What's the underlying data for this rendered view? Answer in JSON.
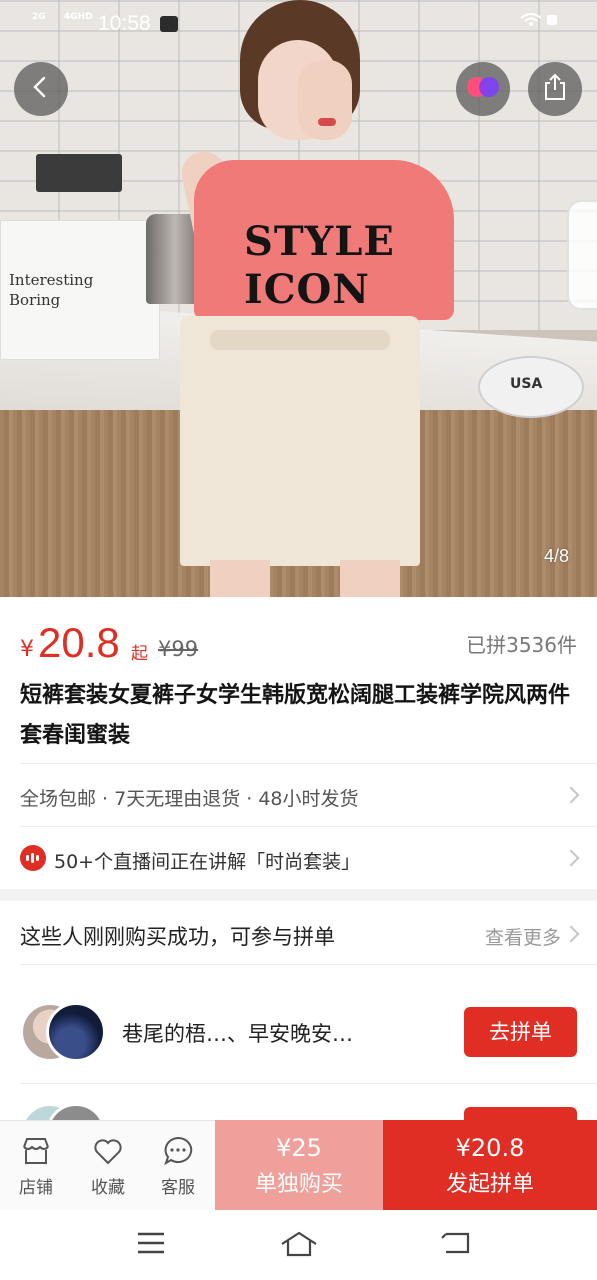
{
  "status_bar": {
    "net1": "2G",
    "net2": "4GHD",
    "time": "10:58"
  },
  "hero": {
    "counter": "4/8",
    "bag_text_1": "Interesting",
    "bag_text_2": "Boring",
    "tshirt_line_1": "STYLE",
    "tshirt_line_2": "ICON",
    "purse_text": "USA"
  },
  "price": {
    "currency": "¥",
    "value": "20.8",
    "suffix": "起",
    "original": "¥99",
    "sold": "已拼3536件"
  },
  "product": {
    "title": "短裤套装女夏裤子女学生韩版宽松阔腿工装裤学院风两件套春闺蜜装"
  },
  "promo": {
    "text": "全场包邮 · 7天无理由退货 · 48小时发货"
  },
  "live": {
    "text": "50+个直播间正在讲解「时尚套装」"
  },
  "group": {
    "header": "这些人刚刚购买成功，可参与拼单",
    "more": "查看更多",
    "items": [
      {
        "names": "巷尾的梧…、早安晚安…",
        "join": "去拼单"
      }
    ]
  },
  "actions": {
    "store": "店铺",
    "favorite": "收藏",
    "service": "客服",
    "solo_price": "¥25",
    "solo_label": "单独购买",
    "group_price": "¥20.8",
    "group_label": "发起拼单"
  },
  "colors": {
    "accent": "#e02e24",
    "accent_light": "#f0a09b"
  }
}
